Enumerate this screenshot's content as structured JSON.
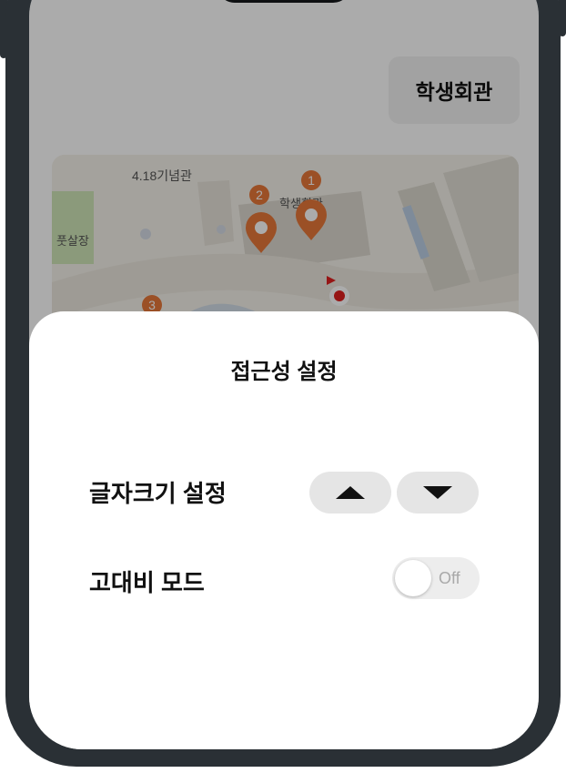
{
  "map": {
    "building_chip": "학생회관",
    "labels": {
      "memorial": "4.18기념관",
      "field": "풋살장",
      "student_union": "학생회관"
    },
    "markers": [
      "1",
      "2",
      "3"
    ]
  },
  "accessibility_sheet": {
    "title": "접근성 설정",
    "font_size_label": "글자크기 설정",
    "high_contrast_label": "고대비 모드",
    "high_contrast_state": "Off"
  },
  "colors": {
    "marker": "#e8783a",
    "location_dot": "#e02020",
    "sheet_bg": "#ffffff",
    "button_bg": "#e5e5e5"
  },
  "icons": [
    "triangle-up-icon",
    "triangle-down-icon",
    "map-pin-icon",
    "location-dot-icon"
  ]
}
